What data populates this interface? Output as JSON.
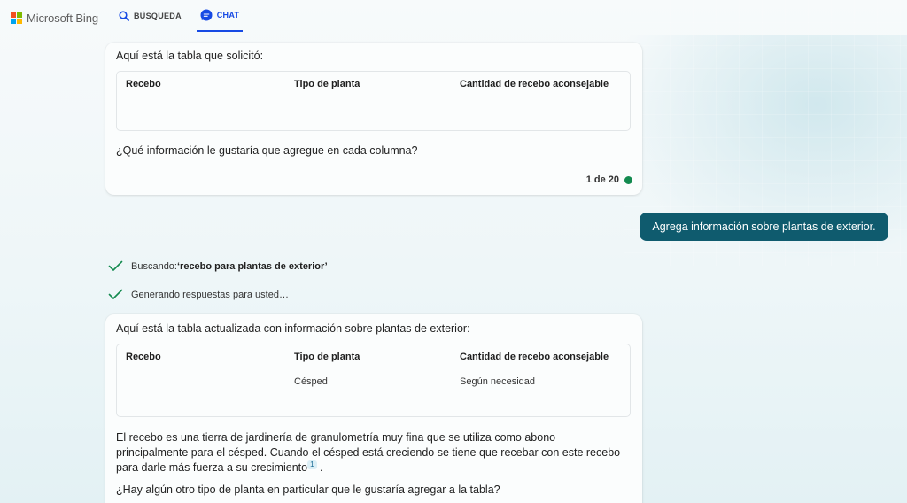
{
  "header": {
    "logo_text": "Microsoft Bing",
    "tabs": [
      {
        "label": "BÚSQUEDA",
        "icon": "search-icon"
      },
      {
        "label": "CHAT",
        "icon": "chat-icon",
        "active": true
      }
    ],
    "accent": "#174ae4"
  },
  "messages": {
    "card1": {
      "intro": "Aquí está la tabla que solicitó:",
      "table": {
        "headers": [
          "Recebo",
          "Tipo de planta",
          "Cantidad de recebo aconsejable"
        ],
        "rows": []
      },
      "question": "¿Qué información le gustaría que agregue en cada columna?",
      "counter": "1 de 20",
      "counter_color": "#138a4f"
    },
    "user_message": "Agrega información sobre plantas de exterior.",
    "user_bubble_color": "#0f5b6e",
    "status": [
      {
        "prefix": "Buscando: ",
        "emphasis": "‘recebo para plantas de exterior’"
      },
      {
        "prefix": "Generando respuestas para usted…",
        "emphasis": ""
      }
    ],
    "card2": {
      "intro": "Aquí está la tabla actualizada con información sobre plantas de exterior:",
      "table": {
        "headers": [
          "Recebo",
          "Tipo de planta",
          "Cantidad de recebo aconsejable"
        ],
        "rows": [
          [
            "",
            "Césped",
            "Según necesidad"
          ]
        ]
      },
      "paragraph": "El recebo es una tierra de jardinería de granulometría muy fina que se utiliza como abono principalmente para el césped. Cuando el césped está creciendo se tiene que recebar con este recebo para darle más fuerza a su crecimiento",
      "citation": "1",
      "paragraph_end": ".",
      "question": "¿Hay algún otro tipo de planta en particular que le gustaría agregar a la tabla?"
    }
  }
}
